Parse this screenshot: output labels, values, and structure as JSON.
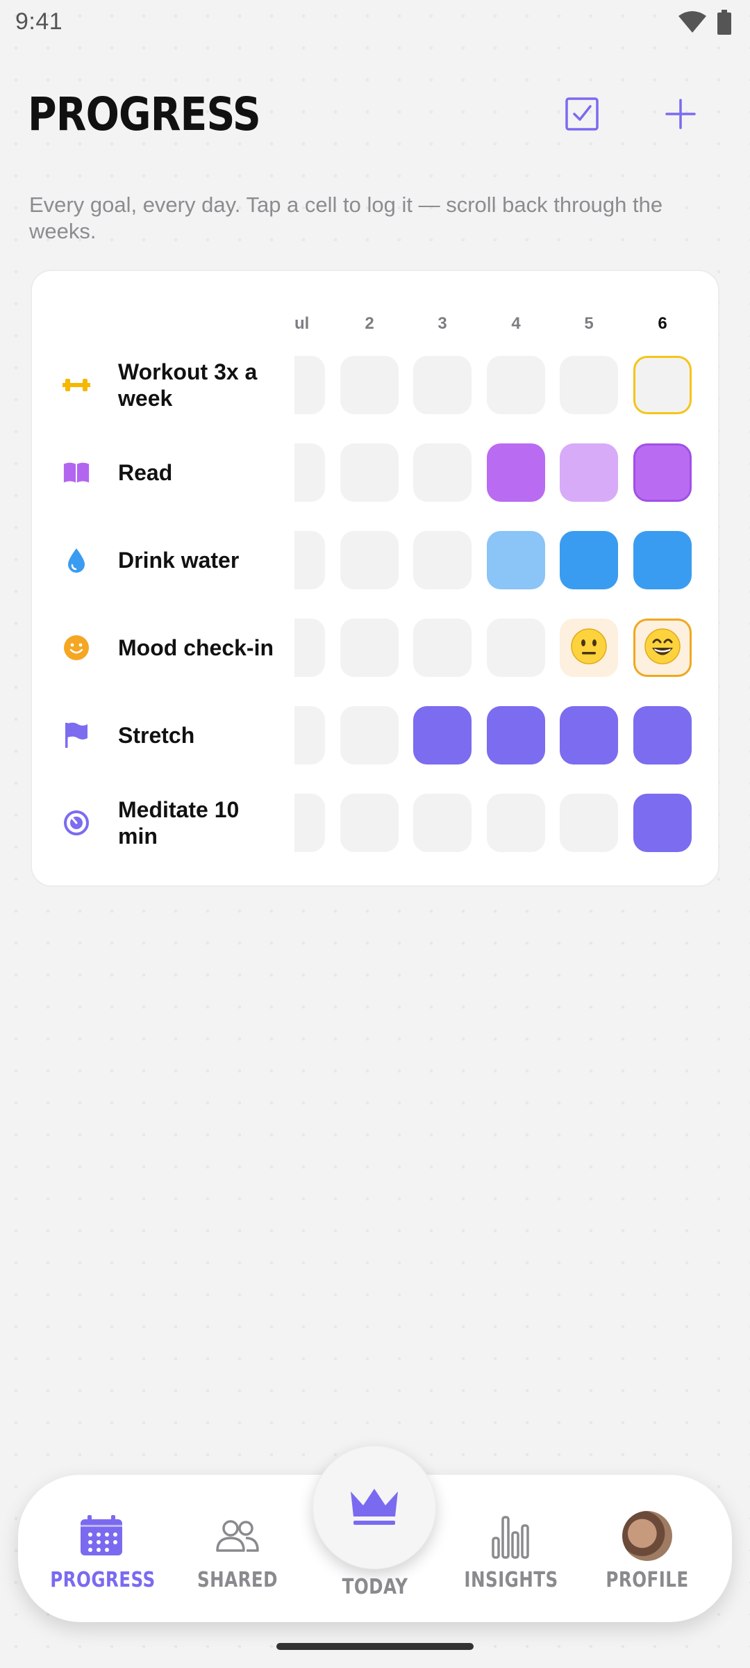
{
  "status_bar": {
    "time": "9:41"
  },
  "header": {
    "title": "PROGRESS",
    "check_icon": "checkbox-icon",
    "add_icon": "plus-icon"
  },
  "subtitle": "Every goal, every day. Tap a cell to log it — scroll back through the weeks.",
  "grid": {
    "days": [
      "ul",
      "2",
      "3",
      "4",
      "5",
      "6"
    ],
    "current_day": "6",
    "goals": [
      {
        "label": "Workout 3x a week",
        "icon": "dumbbell-icon",
        "color": "#f5b700",
        "cells": [
          "empty",
          "empty",
          "empty",
          "empty",
          "empty",
          "empty-today"
        ]
      },
      {
        "label": "Read",
        "icon": "book-icon",
        "color": "#b266ef",
        "cells": [
          "empty",
          "empty",
          "empty",
          "full",
          "light",
          "full-today"
        ]
      },
      {
        "label": "Drink water",
        "icon": "water-drop-icon",
        "color": "#3a9cf0",
        "cells": [
          "empty",
          "empty",
          "empty",
          "light",
          "full",
          "full"
        ]
      },
      {
        "label": "Mood check-in",
        "icon": "smiley-icon",
        "color": "#f5a623",
        "cells": [
          "empty",
          "empty",
          "empty",
          "empty",
          "neutral-face",
          "grin-face-today"
        ]
      },
      {
        "label": "Stretch",
        "icon": "flag-icon",
        "color": "#7b6cf0",
        "cells": [
          "empty",
          "empty",
          "full",
          "full",
          "full",
          "full"
        ]
      },
      {
        "label": "Meditate 10 min",
        "icon": "timer-icon",
        "color": "#7b6cf0",
        "cells": [
          "empty",
          "empty",
          "empty",
          "empty",
          "empty",
          "full"
        ]
      }
    ]
  },
  "nav": {
    "items": [
      {
        "label": "PROGRESS",
        "icon": "calendar-icon",
        "active": true
      },
      {
        "label": "SHARED",
        "icon": "people-icon",
        "active": false
      },
      {
        "label": "TODAY",
        "icon": "crown-icon",
        "active": false
      },
      {
        "label": "INSIGHTS",
        "icon": "bar-chart-icon",
        "active": false
      },
      {
        "label": "PROFILE",
        "icon": "avatar",
        "active": false
      }
    ]
  },
  "colors": {
    "accent": "#7a6af0",
    "today_outline": "#f5c518",
    "mood_outline": "#f0a81e"
  }
}
